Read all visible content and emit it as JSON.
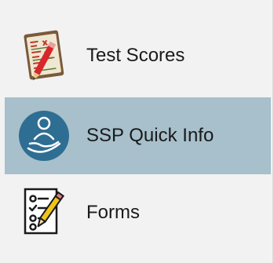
{
  "menu": {
    "items": [
      {
        "label": "Test Scores",
        "icon": "report-card-pencil-icon",
        "selected": false
      },
      {
        "label": "SSP Quick Info",
        "icon": "person-hand-icon",
        "selected": true
      },
      {
        "label": "Forms",
        "icon": "checklist-pencil-icon",
        "selected": false
      }
    ]
  },
  "colors": {
    "background": "#f2f2f3",
    "selected_background": "#a7c0cb",
    "ssp_icon_circle": "#2e6e93",
    "text": "#1a1a1a"
  }
}
